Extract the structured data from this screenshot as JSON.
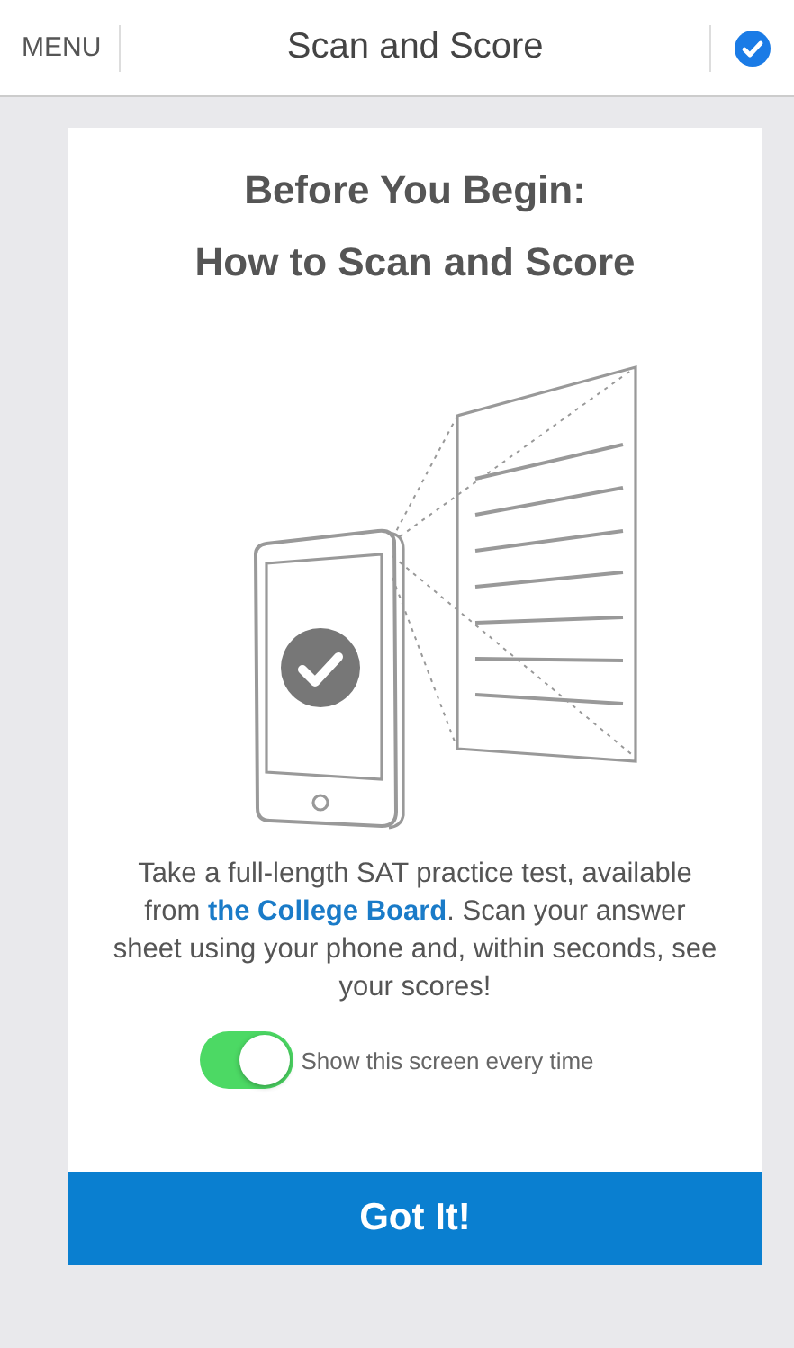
{
  "header": {
    "menu": "MENU",
    "title": "Scan and Score",
    "done_checked": true
  },
  "card": {
    "title_lines": [
      "Before You Begin:",
      "How to Scan and Score"
    ],
    "intro": {
      "before": "Take a full-length SAT practice test, available from ",
      "link": "the College Board",
      "after": ". Scan your answer sheet using your phone and, within seconds, see your scores!"
    },
    "toggle": {
      "label": "Show this screen every time",
      "on": true
    },
    "button": "Got It!"
  }
}
